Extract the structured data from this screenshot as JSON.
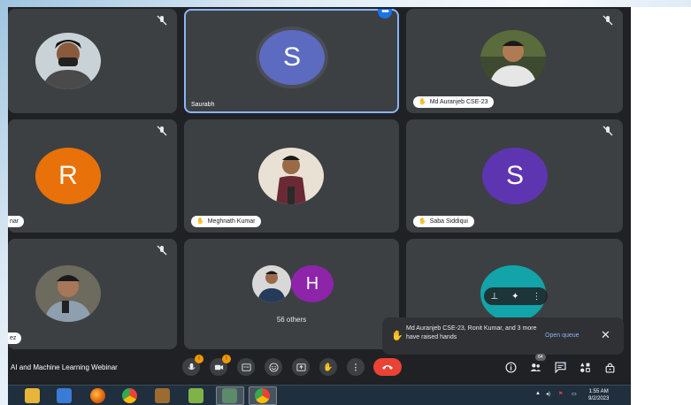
{
  "meeting": {
    "title": "AI and Machine Learning Webinar"
  },
  "participants": [
    {
      "name": "",
      "kind": "photo"
    },
    {
      "name": "Saurabh",
      "kind": "initial",
      "initial": "S",
      "color": "#5c6bc0"
    },
    {
      "name": "Md Auranjeb CSE-23",
      "kind": "photo",
      "hand_raised": true
    },
    {
      "name": "nar",
      "kind": "initial",
      "initial": "R",
      "color": "#e8710a"
    },
    {
      "name": "Meghnath Kumar",
      "kind": "photo",
      "hand_raised": true
    },
    {
      "name": "Saba Siddiqui",
      "kind": "initial",
      "initial": "S",
      "color": "#5e35b1",
      "hand_raised": true
    },
    {
      "name": "ez",
      "kind": "photo"
    },
    {
      "name": "56 others",
      "kind": "group",
      "initial": "H",
      "color": "#8e24aa"
    },
    {
      "name": "",
      "kind": "initial",
      "color": "#12a4a8"
    }
  ],
  "toast": {
    "message": "Md Auranjeb CSE-23, Ronit Kumar, and 3 more have raised hands",
    "action": "Open queue"
  },
  "controls": {
    "mic_badge": "!",
    "camera_badge": "!",
    "people_count": "64"
  },
  "taskbar": {
    "time": "1:55 AM",
    "date": "9/2/2023"
  },
  "colors": {
    "background": "#202124",
    "tile": "#3c4043",
    "accent": "#8ab4f8",
    "end_call": "#ea4335"
  }
}
